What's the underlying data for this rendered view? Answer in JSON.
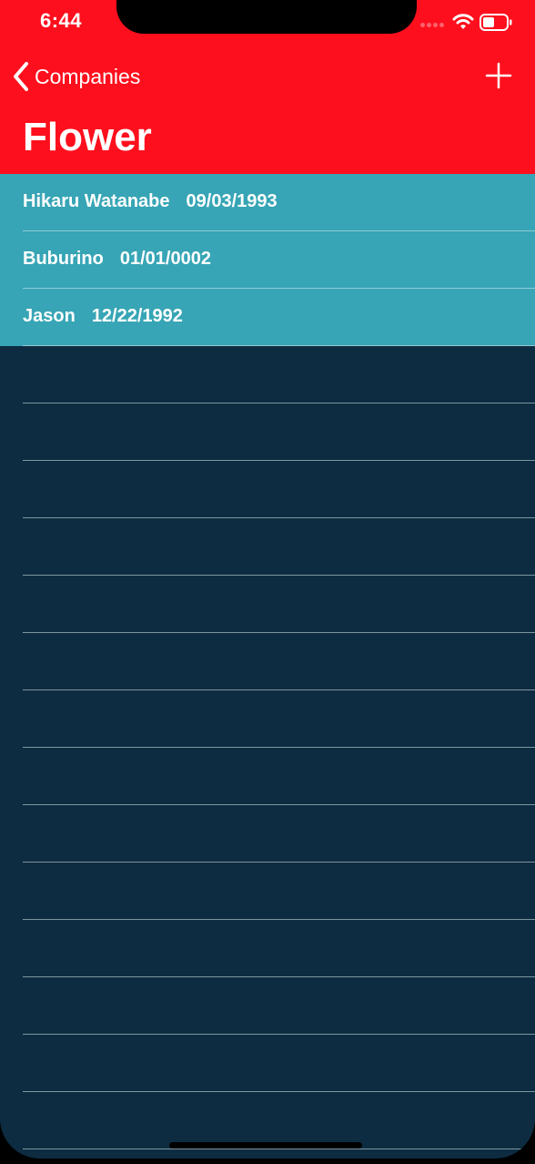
{
  "status_bar": {
    "time": "6:44"
  },
  "nav": {
    "back_label": "Companies",
    "title": "Flower"
  },
  "employees": [
    {
      "name": "Hikaru Watanabe",
      "date": "09/03/1993"
    },
    {
      "name": "Buburino",
      "date": "01/01/0002"
    },
    {
      "name": "Jason",
      "date": "12/22/1992"
    }
  ],
  "colors": {
    "header": "#fe0f1d",
    "row_fill": "#37a5b5",
    "background": "#0d2c41",
    "text": "#ffffff"
  },
  "icons": [
    "wifi-icon",
    "battery-icon",
    "chevron-left-icon",
    "plus-icon"
  ]
}
